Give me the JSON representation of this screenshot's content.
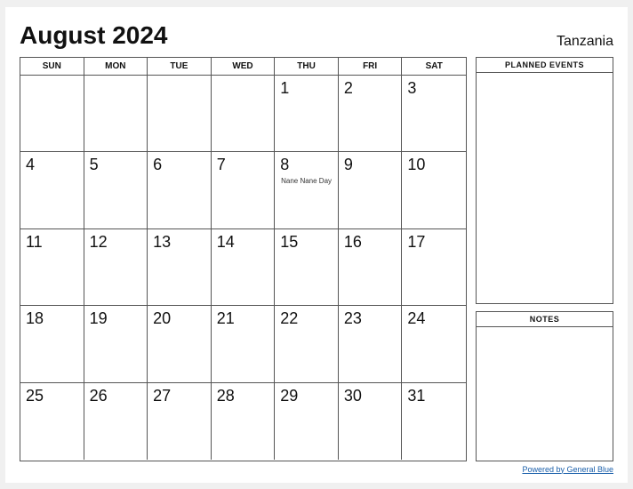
{
  "header": {
    "title": "August 2024",
    "country": "Tanzania"
  },
  "days_of_week": [
    "SUN",
    "MON",
    "TUE",
    "WED",
    "THU",
    "FRI",
    "SAT"
  ],
  "weeks": [
    [
      {
        "num": "",
        "empty": true
      },
      {
        "num": "",
        "empty": true
      },
      {
        "num": "",
        "empty": true
      },
      {
        "num": "",
        "empty": true
      },
      {
        "num": "1",
        "event": ""
      },
      {
        "num": "2",
        "event": ""
      },
      {
        "num": "3",
        "event": ""
      }
    ],
    [
      {
        "num": "4",
        "event": ""
      },
      {
        "num": "5",
        "event": ""
      },
      {
        "num": "6",
        "event": ""
      },
      {
        "num": "7",
        "event": ""
      },
      {
        "num": "8",
        "event": "Nane Nane\nDay"
      },
      {
        "num": "9",
        "event": ""
      },
      {
        "num": "10",
        "event": ""
      }
    ],
    [
      {
        "num": "11",
        "event": ""
      },
      {
        "num": "12",
        "event": ""
      },
      {
        "num": "13",
        "event": ""
      },
      {
        "num": "14",
        "event": ""
      },
      {
        "num": "15",
        "event": ""
      },
      {
        "num": "16",
        "event": ""
      },
      {
        "num": "17",
        "event": ""
      }
    ],
    [
      {
        "num": "18",
        "event": ""
      },
      {
        "num": "19",
        "event": ""
      },
      {
        "num": "20",
        "event": ""
      },
      {
        "num": "21",
        "event": ""
      },
      {
        "num": "22",
        "event": ""
      },
      {
        "num": "23",
        "event": ""
      },
      {
        "num": "24",
        "event": ""
      }
    ],
    [
      {
        "num": "25",
        "event": ""
      },
      {
        "num": "26",
        "event": ""
      },
      {
        "num": "27",
        "event": ""
      },
      {
        "num": "28",
        "event": ""
      },
      {
        "num": "29",
        "event": ""
      },
      {
        "num": "30",
        "event": ""
      },
      {
        "num": "31",
        "event": ""
      }
    ]
  ],
  "sidebar": {
    "planned_label": "PLANNED EVENTS",
    "notes_label": "NOTES"
  },
  "footer": {
    "link_text": "Powered by General Blue",
    "link_url": "#"
  }
}
